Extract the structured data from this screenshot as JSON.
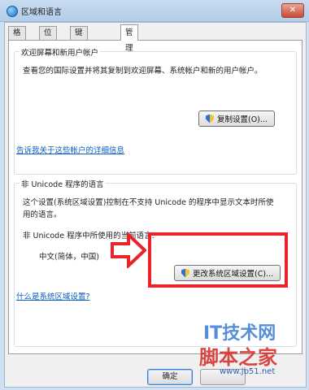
{
  "window": {
    "title": "区域和语言",
    "close": "✕"
  },
  "tabs": [
    {
      "label": "格式"
    },
    {
      "label": "位置"
    },
    {
      "label": "键盘和语言"
    },
    {
      "label": "管理"
    }
  ],
  "welcome_group": {
    "title": "欢迎屏幕和新用户帐户",
    "description": "查看您的国际设置并将其复制到欢迎屏幕、系统帐户和新的用户帐户。",
    "copy_button": "复制设置(O)...",
    "link": "告诉我关于这些帐户的详细信息"
  },
  "unicode_group": {
    "title": "非 Unicode 程序的语言",
    "description_line1": "这个设置(系统区域设置)控制在不支持 Unicode 的程序中显示文本时所使",
    "description_line2": "用的语言。",
    "current_label": "非 Unicode 程序中所使用的当前语言:",
    "current_value": "中文(简体，中国)",
    "change_button": "更改系统区域设置(C)...",
    "link": "什么是系统区域设置?"
  },
  "footer": {
    "ok": "确定"
  },
  "watermark": {
    "line1": "IT技术网",
    "line2": "脚本之家",
    "line3": "www.jb51.net"
  },
  "colors": {
    "highlight": "#e8232a",
    "link": "#0a5bbf"
  }
}
